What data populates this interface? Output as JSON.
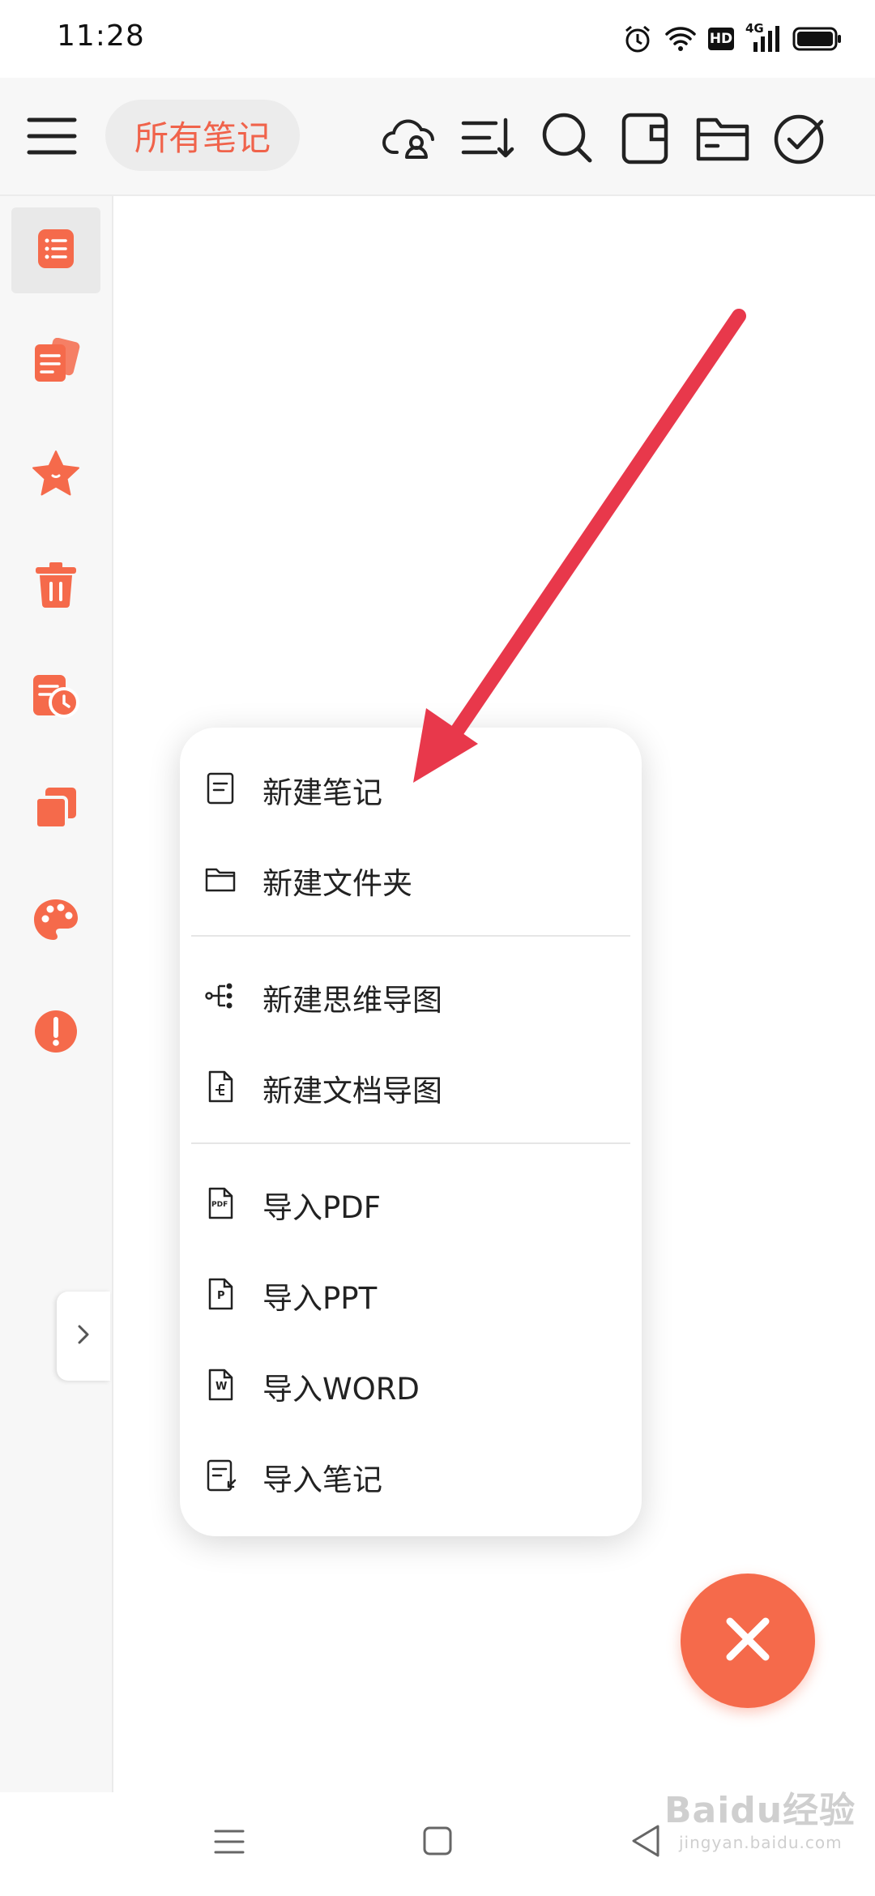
{
  "status_bar": {
    "time": "11:28",
    "hd_label": "HD",
    "network_label": "4G",
    "icons": [
      "alarm-icon",
      "wifi-icon",
      "hd-badge",
      "cellular-signal-icon",
      "battery-icon"
    ]
  },
  "toolbar": {
    "title": "所有笔记",
    "icons": [
      "menu-icon",
      "cloud-user-icon",
      "sort-icon",
      "search-icon",
      "notebook-icon",
      "folder-icon",
      "check-circle-icon"
    ]
  },
  "sidebar": {
    "items": [
      {
        "icon": "note-list-icon",
        "active": true
      },
      {
        "icon": "notes-stack-icon",
        "active": false
      },
      {
        "icon": "star-icon",
        "active": false
      },
      {
        "icon": "trash-icon",
        "active": false
      },
      {
        "icon": "history-icon",
        "active": false
      },
      {
        "icon": "copy-icon",
        "active": false
      },
      {
        "icon": "palette-icon",
        "active": false
      },
      {
        "icon": "exclamation-icon",
        "active": false
      }
    ],
    "expand_icon": "chevron-right-icon"
  },
  "menu": {
    "new_note": "新建笔记",
    "new_folder": "新建文件夹",
    "new_mindmap": "新建思维导图",
    "new_doc_map": "新建文档导图",
    "import_pdf": "导入PDF",
    "import_ppt": "导入PPT",
    "import_word": "导入WORD",
    "import_notes": "导入笔记",
    "pdf_glyph": "PDF",
    "ppt_glyph": "P",
    "word_glyph": "W"
  },
  "fab": {
    "icon": "close-icon"
  },
  "navbar": {
    "icons": [
      "recent-apps-icon",
      "home-icon",
      "back-icon"
    ]
  },
  "watermark": {
    "text": "Baidu经验",
    "sub": "jingyan.baidu.com"
  },
  "colors": {
    "accent": "#f0634b",
    "fab": "#f56a4b",
    "arrow": "#e8384b",
    "sidebar_bg": "#f7f7f7"
  }
}
